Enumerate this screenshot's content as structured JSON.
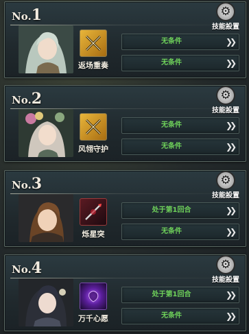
{
  "panels": [
    {
      "rank_prefix": "No.",
      "rank_number": "1",
      "skill_settings_label": "技能設置",
      "skill_name": "返场重奏",
      "skill_icon": "crossed-swords-icon",
      "conditions": [
        "无条件",
        "无条件"
      ]
    },
    {
      "rank_prefix": "No.",
      "rank_number": "2",
      "skill_settings_label": "技能設置",
      "skill_name": "风翎守护",
      "skill_icon": "crossed-swords-icon",
      "conditions": [
        "无条件",
        "无条件"
      ]
    },
    {
      "rank_prefix": "No.",
      "rank_number": "3",
      "skill_settings_label": "技能設置",
      "skill_name": "烁星突",
      "skill_icon": "spear-icon",
      "conditions": [
        "处于第1回合",
        "无条件"
      ]
    },
    {
      "rank_prefix": "No.",
      "rank_number": "4",
      "skill_settings_label": "技能設置",
      "skill_name": "万千心愿",
      "skill_icon": "purple-orb-icon",
      "conditions": [
        "处于第1回合",
        "无条件"
      ]
    }
  ],
  "colors": {
    "condition_text": "#6fd25a",
    "panel_bg": "#2b3a40",
    "panel_border": "#5c6a64"
  }
}
